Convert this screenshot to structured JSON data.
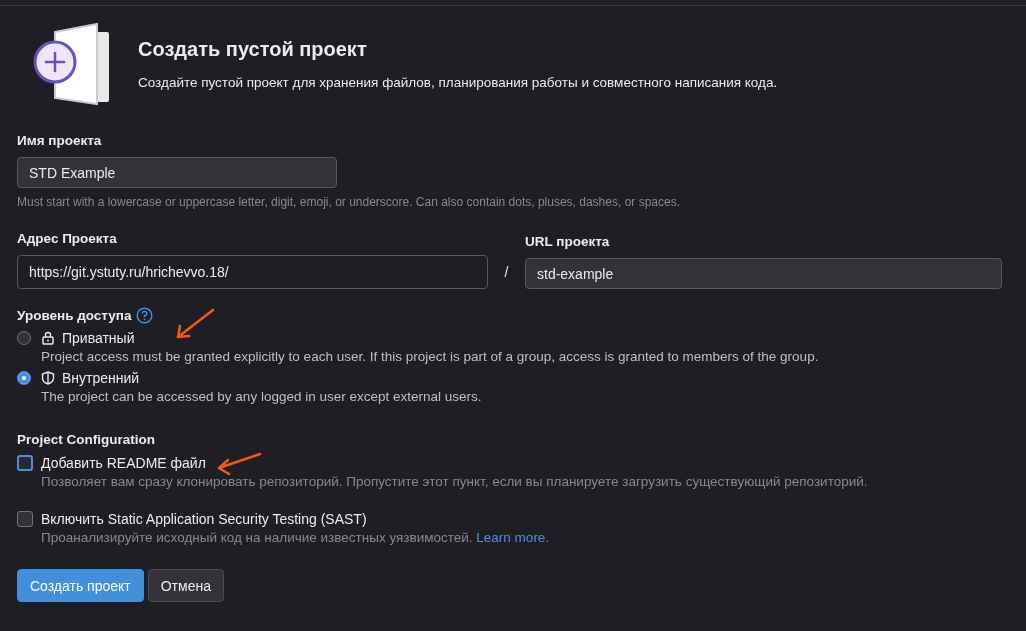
{
  "header": {
    "title": "Создать пустой проект",
    "description": "Создайте пустой проект для хранения файлов, планирования работы и совместного написания кода."
  },
  "project_name": {
    "label": "Имя проекта",
    "value": "STD Example",
    "hint": "Must start with a lowercase or uppercase letter, digit, emoji, or underscore. Can also contain dots, pluses, dashes, or spaces."
  },
  "project_address": {
    "label": "Адрес Проекта",
    "value": "https://git.ystuty.ru/hrichevvo.18/",
    "separator": "/"
  },
  "project_url": {
    "label": "URL проекта",
    "value": "std-example"
  },
  "visibility": {
    "label": "Уровень доступа",
    "options": [
      {
        "kind": "lock",
        "label": "Приватный",
        "description": "Project access must be granted explicitly to each user. If this project is part of a group, access is granted to members of the group.",
        "selected": false
      },
      {
        "kind": "shield",
        "label": "Внутренний",
        "description": "The project can be accessed by any logged in user except external users.",
        "selected": true
      }
    ]
  },
  "configuration": {
    "label": "Project Configuration",
    "options": [
      {
        "label": "Добавить README файл",
        "description": "Позволяет вам сразу клонировать репозиторий. Пропустите этот пункт, если вы планируете загрузить существующий репозиторий.",
        "checked": false,
        "focused": true
      },
      {
        "label": "Включить Static Application Security Testing (SAST)",
        "description": "Проанализируйте исходный код на наличие известных уязвимостей.",
        "link": "Learn more.",
        "checked": false,
        "focused": false
      }
    ]
  },
  "buttons": [
    {
      "kind": "primary",
      "label": "Создать проект"
    },
    {
      "kind": "secondary",
      "label": "Отмена"
    }
  ]
}
